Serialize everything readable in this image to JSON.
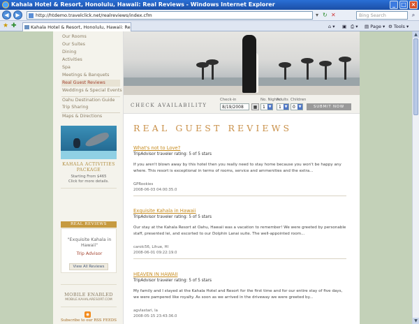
{
  "browser": {
    "window_title": "Kahala Hotel & Resort, Honolulu, Hawaii: Real Reviews - Windows Internet Explorer",
    "url": "http://htdemo.travelclick.net/realreviews/index.cfm",
    "search_placeholder": "Bing Search",
    "tab_label": "Kahala Hotel & Resort, Honolulu, Hawaii: Real Reviews",
    "page_menu": "Page",
    "tools_menu": "Tools"
  },
  "sidebar": {
    "nav": [
      {
        "label": "Our Rooms"
      },
      {
        "label": "Our Suites"
      },
      {
        "label": "Dining"
      },
      {
        "label": "Activities"
      },
      {
        "label": "Spa"
      },
      {
        "label": "Meetings & Banquets"
      },
      {
        "label": "Real Guest Reviews",
        "active": true
      },
      {
        "label": "Weddings & Special Events"
      },
      {
        "label": "Oahu Destination Guide"
      },
      {
        "label": "Trip Sharing"
      },
      {
        "label": "Maps & Directions"
      }
    ],
    "promo": {
      "title": "KAHALA ACTIVITIES PACKAGE",
      "price": "Starting From $465",
      "cta": "Click for more details."
    },
    "real_reviews_widget": {
      "tab": "REAL REVIEWS",
      "quote": "\"Exquisite Kahala in Hawaii\"",
      "source": "Trip Advisor",
      "button": "View All Reviews"
    },
    "mobile": {
      "title": "MOBILE ENABLED",
      "url": "MOBILE.KAHALARESORT.COM"
    },
    "rss": {
      "label": "Subscribe to our RSS FEEDS"
    }
  },
  "availability": {
    "heading": "CHECK AVAILABILITY",
    "checkin_label": "Check-in",
    "checkin_value": "8/19/2008",
    "nights_label": "No. Nights",
    "nights_value": "1",
    "adults_label": "Adults",
    "adults_value": "1",
    "children_label": "Children",
    "children_value": "0",
    "submit": "SUBMIT NOW"
  },
  "page_title": "REAL GUEST REVIEWS",
  "reviews": [
    {
      "title": "What's not to Love?",
      "rating": "TripAdvisor traveler rating: 5 of 5 stars",
      "body": "If you aren't blown away by this hotel then you really need to stay home because you won't be happy any where. This resort is exceptional in terms of rooms, service and ammenities and the extra...",
      "author": "GPRookies",
      "date": "2008-06-03 04:00:35.0"
    },
    {
      "title": "Exquisite Kahala in Hawaii",
      "rating": "TripAdvisor traveler rating: 5 of 5 stars",
      "body": "Our stay at the Kahala Resort at Oahu, Hawaii was a vacation to remember! We were greeted by personable staff, presented lei, and escorted to our Dolphin Lanai suite. The well-appointed room...",
      "author": "carolc56, Lihue, HI",
      "date": "2008-06-01 09:22:19.0"
    },
    {
      "title": "HEAVEN IN HAWAII",
      "rating": "TripAdvisor traveler rating: 5 of 5 stars",
      "body": "My family and I stayed at the Kahala Hotel and Resort for the first time and for our entire stay of five days, we were pampered like royalty. As soon as we arrived in the driveway we were greeted by...",
      "author": "agvlastari, la",
      "date": "2008-05-15 23:43:36.0"
    }
  ]
}
